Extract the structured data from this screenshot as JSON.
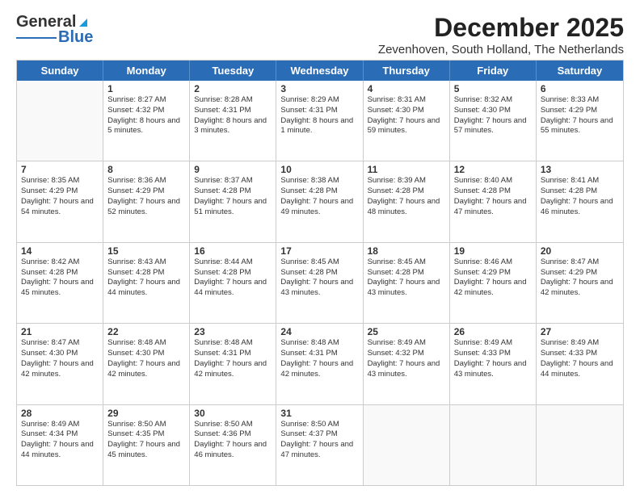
{
  "header": {
    "logo_line1": "General",
    "logo_line2": "Blue",
    "month": "December 2025",
    "location": "Zevenhoven, South Holland, The Netherlands"
  },
  "weekdays": [
    "Sunday",
    "Monday",
    "Tuesday",
    "Wednesday",
    "Thursday",
    "Friday",
    "Saturday"
  ],
  "rows": [
    [
      {
        "day": "",
        "sunrise": "",
        "sunset": "",
        "daylight": ""
      },
      {
        "day": "1",
        "sunrise": "Sunrise: 8:27 AM",
        "sunset": "Sunset: 4:32 PM",
        "daylight": "Daylight: 8 hours and 5 minutes."
      },
      {
        "day": "2",
        "sunrise": "Sunrise: 8:28 AM",
        "sunset": "Sunset: 4:31 PM",
        "daylight": "Daylight: 8 hours and 3 minutes."
      },
      {
        "day": "3",
        "sunrise": "Sunrise: 8:29 AM",
        "sunset": "Sunset: 4:31 PM",
        "daylight": "Daylight: 8 hours and 1 minute."
      },
      {
        "day": "4",
        "sunrise": "Sunrise: 8:31 AM",
        "sunset": "Sunset: 4:30 PM",
        "daylight": "Daylight: 7 hours and 59 minutes."
      },
      {
        "day": "5",
        "sunrise": "Sunrise: 8:32 AM",
        "sunset": "Sunset: 4:30 PM",
        "daylight": "Daylight: 7 hours and 57 minutes."
      },
      {
        "day": "6",
        "sunrise": "Sunrise: 8:33 AM",
        "sunset": "Sunset: 4:29 PM",
        "daylight": "Daylight: 7 hours and 55 minutes."
      }
    ],
    [
      {
        "day": "7",
        "sunrise": "Sunrise: 8:35 AM",
        "sunset": "Sunset: 4:29 PM",
        "daylight": "Daylight: 7 hours and 54 minutes."
      },
      {
        "day": "8",
        "sunrise": "Sunrise: 8:36 AM",
        "sunset": "Sunset: 4:29 PM",
        "daylight": "Daylight: 7 hours and 52 minutes."
      },
      {
        "day": "9",
        "sunrise": "Sunrise: 8:37 AM",
        "sunset": "Sunset: 4:28 PM",
        "daylight": "Daylight: 7 hours and 51 minutes."
      },
      {
        "day": "10",
        "sunrise": "Sunrise: 8:38 AM",
        "sunset": "Sunset: 4:28 PM",
        "daylight": "Daylight: 7 hours and 49 minutes."
      },
      {
        "day": "11",
        "sunrise": "Sunrise: 8:39 AM",
        "sunset": "Sunset: 4:28 PM",
        "daylight": "Daylight: 7 hours and 48 minutes."
      },
      {
        "day": "12",
        "sunrise": "Sunrise: 8:40 AM",
        "sunset": "Sunset: 4:28 PM",
        "daylight": "Daylight: 7 hours and 47 minutes."
      },
      {
        "day": "13",
        "sunrise": "Sunrise: 8:41 AM",
        "sunset": "Sunset: 4:28 PM",
        "daylight": "Daylight: 7 hours and 46 minutes."
      }
    ],
    [
      {
        "day": "14",
        "sunrise": "Sunrise: 8:42 AM",
        "sunset": "Sunset: 4:28 PM",
        "daylight": "Daylight: 7 hours and 45 minutes."
      },
      {
        "day": "15",
        "sunrise": "Sunrise: 8:43 AM",
        "sunset": "Sunset: 4:28 PM",
        "daylight": "Daylight: 7 hours and 44 minutes."
      },
      {
        "day": "16",
        "sunrise": "Sunrise: 8:44 AM",
        "sunset": "Sunset: 4:28 PM",
        "daylight": "Daylight: 7 hours and 44 minutes."
      },
      {
        "day": "17",
        "sunrise": "Sunrise: 8:45 AM",
        "sunset": "Sunset: 4:28 PM",
        "daylight": "Daylight: 7 hours and 43 minutes."
      },
      {
        "day": "18",
        "sunrise": "Sunrise: 8:45 AM",
        "sunset": "Sunset: 4:28 PM",
        "daylight": "Daylight: 7 hours and 43 minutes."
      },
      {
        "day": "19",
        "sunrise": "Sunrise: 8:46 AM",
        "sunset": "Sunset: 4:29 PM",
        "daylight": "Daylight: 7 hours and 42 minutes."
      },
      {
        "day": "20",
        "sunrise": "Sunrise: 8:47 AM",
        "sunset": "Sunset: 4:29 PM",
        "daylight": "Daylight: 7 hours and 42 minutes."
      }
    ],
    [
      {
        "day": "21",
        "sunrise": "Sunrise: 8:47 AM",
        "sunset": "Sunset: 4:30 PM",
        "daylight": "Daylight: 7 hours and 42 minutes."
      },
      {
        "day": "22",
        "sunrise": "Sunrise: 8:48 AM",
        "sunset": "Sunset: 4:30 PM",
        "daylight": "Daylight: 7 hours and 42 minutes."
      },
      {
        "day": "23",
        "sunrise": "Sunrise: 8:48 AM",
        "sunset": "Sunset: 4:31 PM",
        "daylight": "Daylight: 7 hours and 42 minutes."
      },
      {
        "day": "24",
        "sunrise": "Sunrise: 8:48 AM",
        "sunset": "Sunset: 4:31 PM",
        "daylight": "Daylight: 7 hours and 42 minutes."
      },
      {
        "day": "25",
        "sunrise": "Sunrise: 8:49 AM",
        "sunset": "Sunset: 4:32 PM",
        "daylight": "Daylight: 7 hours and 43 minutes."
      },
      {
        "day": "26",
        "sunrise": "Sunrise: 8:49 AM",
        "sunset": "Sunset: 4:33 PM",
        "daylight": "Daylight: 7 hours and 43 minutes."
      },
      {
        "day": "27",
        "sunrise": "Sunrise: 8:49 AM",
        "sunset": "Sunset: 4:33 PM",
        "daylight": "Daylight: 7 hours and 44 minutes."
      }
    ],
    [
      {
        "day": "28",
        "sunrise": "Sunrise: 8:49 AM",
        "sunset": "Sunset: 4:34 PM",
        "daylight": "Daylight: 7 hours and 44 minutes."
      },
      {
        "day": "29",
        "sunrise": "Sunrise: 8:50 AM",
        "sunset": "Sunset: 4:35 PM",
        "daylight": "Daylight: 7 hours and 45 minutes."
      },
      {
        "day": "30",
        "sunrise": "Sunrise: 8:50 AM",
        "sunset": "Sunset: 4:36 PM",
        "daylight": "Daylight: 7 hours and 46 minutes."
      },
      {
        "day": "31",
        "sunrise": "Sunrise: 8:50 AM",
        "sunset": "Sunset: 4:37 PM",
        "daylight": "Daylight: 7 hours and 47 minutes."
      },
      {
        "day": "",
        "sunrise": "",
        "sunset": "",
        "daylight": ""
      },
      {
        "day": "",
        "sunrise": "",
        "sunset": "",
        "daylight": ""
      },
      {
        "day": "",
        "sunrise": "",
        "sunset": "",
        "daylight": ""
      }
    ]
  ]
}
